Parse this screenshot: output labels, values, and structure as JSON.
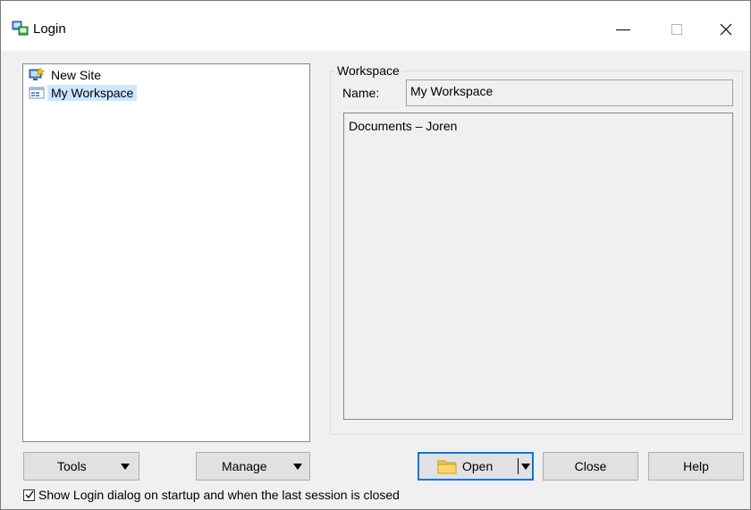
{
  "window": {
    "title": "Login",
    "controls": {
      "minimize": "—",
      "maximize": "□",
      "close": "✕"
    }
  },
  "sites_tree": {
    "items": [
      {
        "label": "New Site",
        "icon": "new-site-icon",
        "selected": false
      },
      {
        "label": "My Workspace",
        "icon": "workspace-icon",
        "selected": true
      }
    ]
  },
  "workspace": {
    "group_title": "Workspace",
    "name_label": "Name:",
    "name_value": "My Workspace",
    "items": [
      "Documents – Joren"
    ]
  },
  "buttons": {
    "tools": "Tools",
    "manage": "Manage",
    "open": "Open",
    "close": "Close",
    "help": "Help"
  },
  "startup_option": {
    "label": "Show Login dialog on startup and when the last session is closed",
    "checked": true
  },
  "colors": {
    "selection": "#cce8ff",
    "default_button_border": "#0078d7",
    "button_face": "#e1e1e1",
    "dialog_bg": "#f0f0f0"
  }
}
